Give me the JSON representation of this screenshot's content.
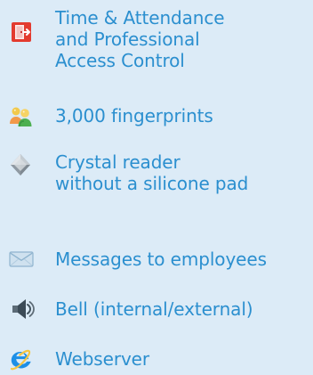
{
  "features": [
    {
      "icon": "door-exit-icon",
      "lines": [
        "Time & Attendance",
        "and Professional",
        "Access Control"
      ]
    },
    {
      "icon": "users-icon",
      "lines": [
        "3,000 fingerprints"
      ]
    },
    {
      "icon": "crystal-reader-icon",
      "lines": [
        "Crystal reader",
        "without a silicone pad"
      ]
    },
    {
      "icon": "envelope-icon",
      "lines": [
        "Messages to employees"
      ]
    },
    {
      "icon": "speaker-icon",
      "lines": [
        "Bell (internal/external)"
      ]
    },
    {
      "icon": "internet-explorer-icon",
      "lines": [
        "Webserver"
      ]
    }
  ]
}
